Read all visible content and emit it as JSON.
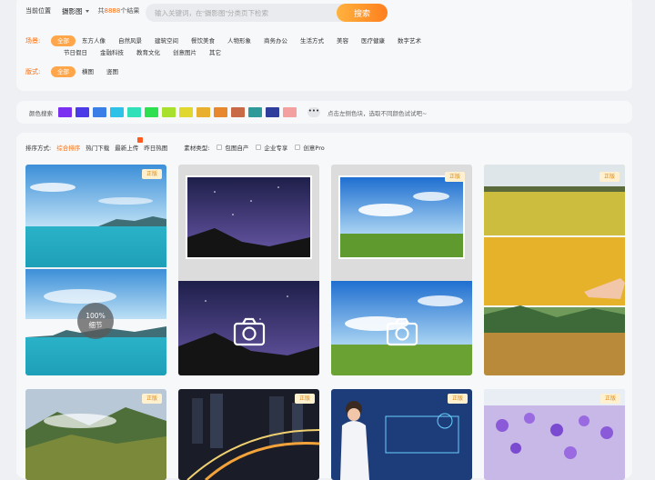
{
  "search": {
    "location_label": "当前位置",
    "category": "摄影图",
    "count_prefix": "共",
    "count": "8888",
    "count_suffix": "个结果",
    "placeholder": "输入关键词，在“摄影图”分类页下检索",
    "button": "搜索"
  },
  "filters": {
    "scene_label": "场景:",
    "scenes_line1": [
      "全部",
      "东方人像",
      "自然风景",
      "建筑空间",
      "餐饮美食",
      "人物形象",
      "商务办公",
      "生活方式",
      "美容",
      "医疗健康",
      "数字艺术"
    ],
    "scenes_line2": [
      "节日假日",
      "金融科技",
      "教育文化",
      "创意图片",
      "其它"
    ],
    "format_label": "版式:",
    "formats": [
      "全部",
      "横图",
      "竖图"
    ]
  },
  "colors": {
    "label": "颜色搜索",
    "swatches": [
      "#7b2ff0",
      "#4a3ae8",
      "#3a7ee8",
      "#2fc2e8",
      "#2fe0b8",
      "#2ee050",
      "#a8e02e",
      "#e0d82e",
      "#e8b02e",
      "#e8882e",
      "#c86a45",
      "#2e9a9a",
      "#2e3e9a",
      "#f5a0a0"
    ],
    "more": "•••",
    "hint": "点击左侧色块，选取不同颜色试试吧~"
  },
  "sort": {
    "label": "排序方式:",
    "options": [
      "综合排序",
      "热门下载",
      "最新上传",
      "昨日热图"
    ],
    "type_label": "素材类型:",
    "types": [
      "包图自产",
      "企业专享",
      "创意Pro"
    ]
  },
  "gallery": {
    "badge": "正版",
    "zoom_line1": "100%",
    "zoom_line2": "细节",
    "icons": [
      "camera-icon"
    ]
  }
}
